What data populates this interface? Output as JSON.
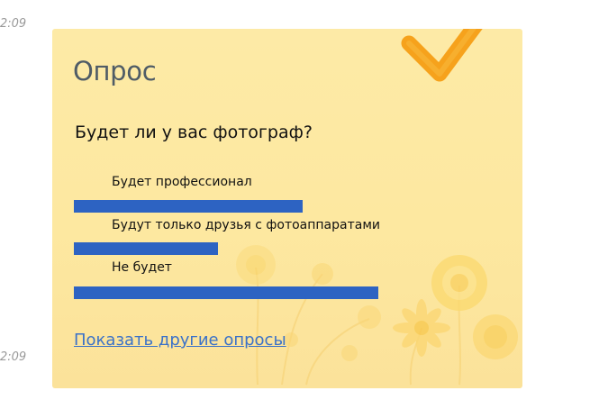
{
  "timestamps": [
    "2:09",
    "2:09"
  ],
  "poll": {
    "title": "Опрос",
    "question": "Будет ли у вас фотограф?",
    "answers": [
      {
        "label": "Будет профессионал",
        "share": 0.54
      },
      {
        "label": "Будут только друзья с фотоаппаратами",
        "share": 0.34
      },
      {
        "label": "Не будет",
        "share": 0.72
      }
    ],
    "more_link": "Показать другие опросы"
  },
  "colors": {
    "card_background": "#fde8a0",
    "bar": "#2d63c2",
    "link": "#3b72c8",
    "checkmark": "#f6a21c"
  },
  "icons": {
    "checkmark": "checkmark-icon",
    "flowers": "flower-decoration"
  }
}
